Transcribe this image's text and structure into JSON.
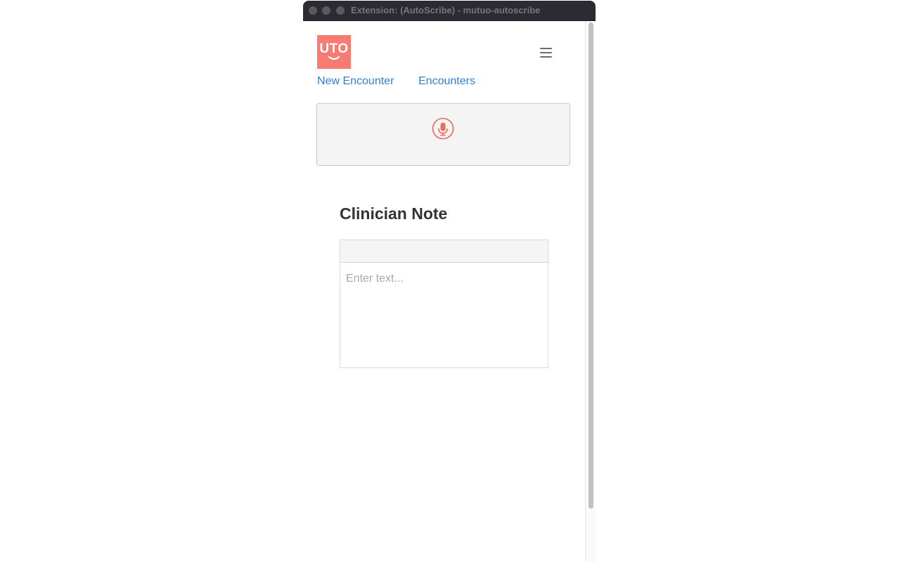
{
  "window": {
    "title": "Extension: (AutoScribe) - mutuo-autoscribe"
  },
  "logo": {
    "text": "UTO"
  },
  "nav": {
    "new_encounter": "New Encounter",
    "encounters": "Encounters"
  },
  "recorder": {
    "icon": "microphone-icon"
  },
  "note": {
    "title": "Clinician Note",
    "placeholder": "Enter text...",
    "value": ""
  },
  "colors": {
    "brand": "#f77b71",
    "link": "#2f80d7",
    "mic": "#f06a5c"
  }
}
